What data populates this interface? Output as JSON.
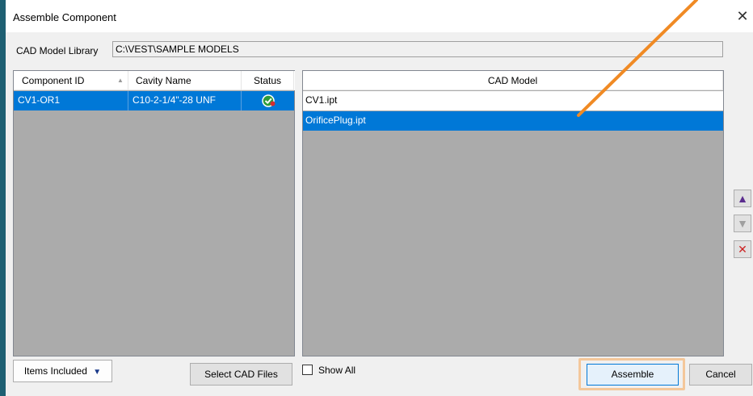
{
  "window": {
    "title": "Assemble Component",
    "close_glyph": "✕"
  },
  "library": {
    "label": "CAD Model Library",
    "path": "C:\\VEST\\SAMPLE MODELS"
  },
  "components_table": {
    "headers": {
      "component_id": "Component ID",
      "sort_glyph": "▲",
      "cavity_name": "Cavity Name",
      "status": "Status"
    },
    "rows": [
      {
        "component_id": "CV1-OR1",
        "cavity_name": "C10-2-1/4\"-28 UNF",
        "status_icon": "check-circle-icon"
      }
    ]
  },
  "cad_table": {
    "header": "CAD Model",
    "rows": [
      {
        "name": "CV1.ipt",
        "selected": false
      },
      {
        "name": "OrificePlug.ipt",
        "selected": true
      }
    ]
  },
  "side_buttons": {
    "up": "▲",
    "down": "▼",
    "remove": "✕"
  },
  "buttons": {
    "items_included": "Items Included",
    "items_included_glyph": "▼",
    "select_cad_files": "Select CAD Files",
    "assemble": "Assemble",
    "cancel": "Cancel"
  },
  "show_all": {
    "label": "Show All",
    "checked": false
  },
  "colors": {
    "accent": "#0078d7",
    "panel_bg": "#ababab",
    "annotation": "#f08a24",
    "up_arrow": "#5b2d8e",
    "remove_x": "#cc2222"
  }
}
